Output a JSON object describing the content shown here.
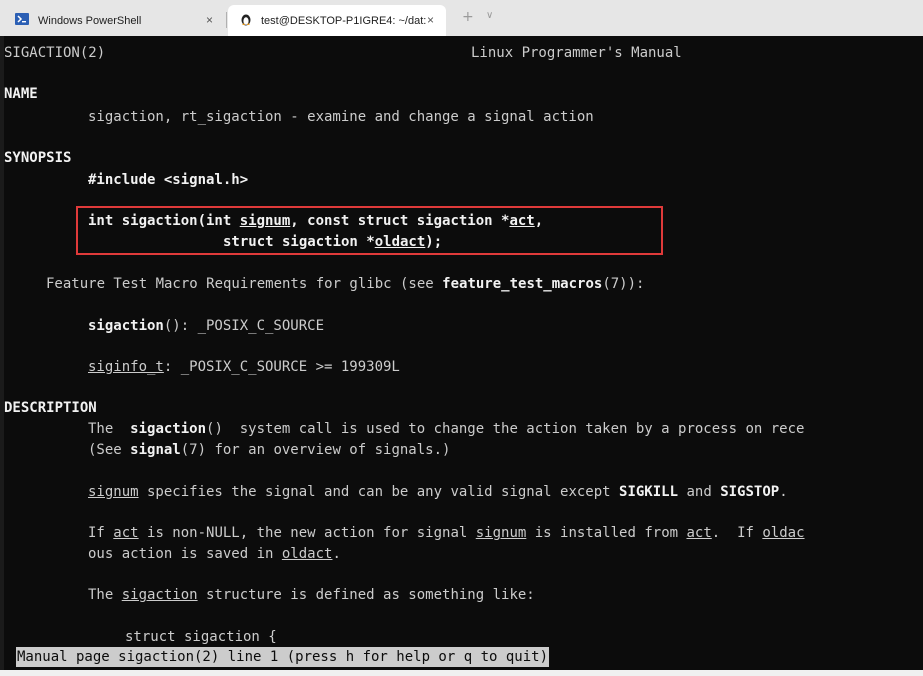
{
  "tabs": [
    {
      "label": "Windows PowerShell",
      "icon": "powershell-icon",
      "close": "×",
      "active": false
    },
    {
      "label": "test@DESKTOP-P1IGRE4: ~/dat:",
      "icon": "linux-penguin-icon",
      "close": "×",
      "active": true
    }
  ],
  "tabbar": {
    "new_tab": "+",
    "dropdown": "∨"
  },
  "manpage": {
    "header_left": "SIGACTION(2)",
    "header_center": "Linux Programmer's Manual",
    "name_heading": "NAME",
    "name_text": "sigaction, rt_sigaction - examine and change a signal action",
    "synopsis_heading": "SYNOPSIS",
    "include": "#include <signal.h>",
    "proto1_a": "int sigaction(int ",
    "proto1_signum": "signum",
    "proto1_b": ", const struct sigaction *",
    "proto1_act": "act",
    "proto1_c": ",",
    "proto2_a": "struct sigaction *",
    "proto2_oldact": "oldact",
    "proto2_b": ");",
    "ftm_a": "Feature Test Macro Requirements for glibc (see ",
    "ftm_b": "feature_test_macros",
    "ftm_c": "(7)):",
    "ftm1_a": "sigaction",
    "ftm1_b": "(): _POSIX_C_SOURCE",
    "ftm2_a": "siginfo_t",
    "ftm2_b": ": _POSIX_C_SOURCE >= 199309L",
    "description_heading": "DESCRIPTION",
    "desc1_a": "The  ",
    "desc1_b": "sigaction",
    "desc1_c": "()  system call is used to change the action taken by a process on rece",
    "desc2_a": "(See ",
    "desc2_b": "signal",
    "desc2_c": "(7) for an overview of signals.)",
    "desc3_a": "signum",
    "desc3_b": " specifies the signal and can be any valid signal except ",
    "desc3_c": "SIGKILL",
    "desc3_d": " and ",
    "desc3_e": "SIGSTOP",
    "desc3_f": ".",
    "desc4_a": "If ",
    "desc4_b": "act",
    "desc4_c": " is non-NULL, the new action for signal ",
    "desc4_d": "signum",
    "desc4_e": " is installed from ",
    "desc4_f": "act",
    "desc4_g": ".  If ",
    "desc4_h": "oldac",
    "desc5_a": "ous action is saved in ",
    "desc5_b": "oldact",
    "desc5_c": ".",
    "desc6_a": "The ",
    "desc6_b": "sigaction",
    "desc6_c": " structure is defined as something like:",
    "struct_line": "struct sigaction {",
    "status": "Manual page sigaction(2) line 1 (press h for help or q to quit)"
  },
  "colors": {
    "terminal_bg": "#0c0c0c",
    "text": "#cccccc",
    "highlight_box": "#e03a3a"
  }
}
